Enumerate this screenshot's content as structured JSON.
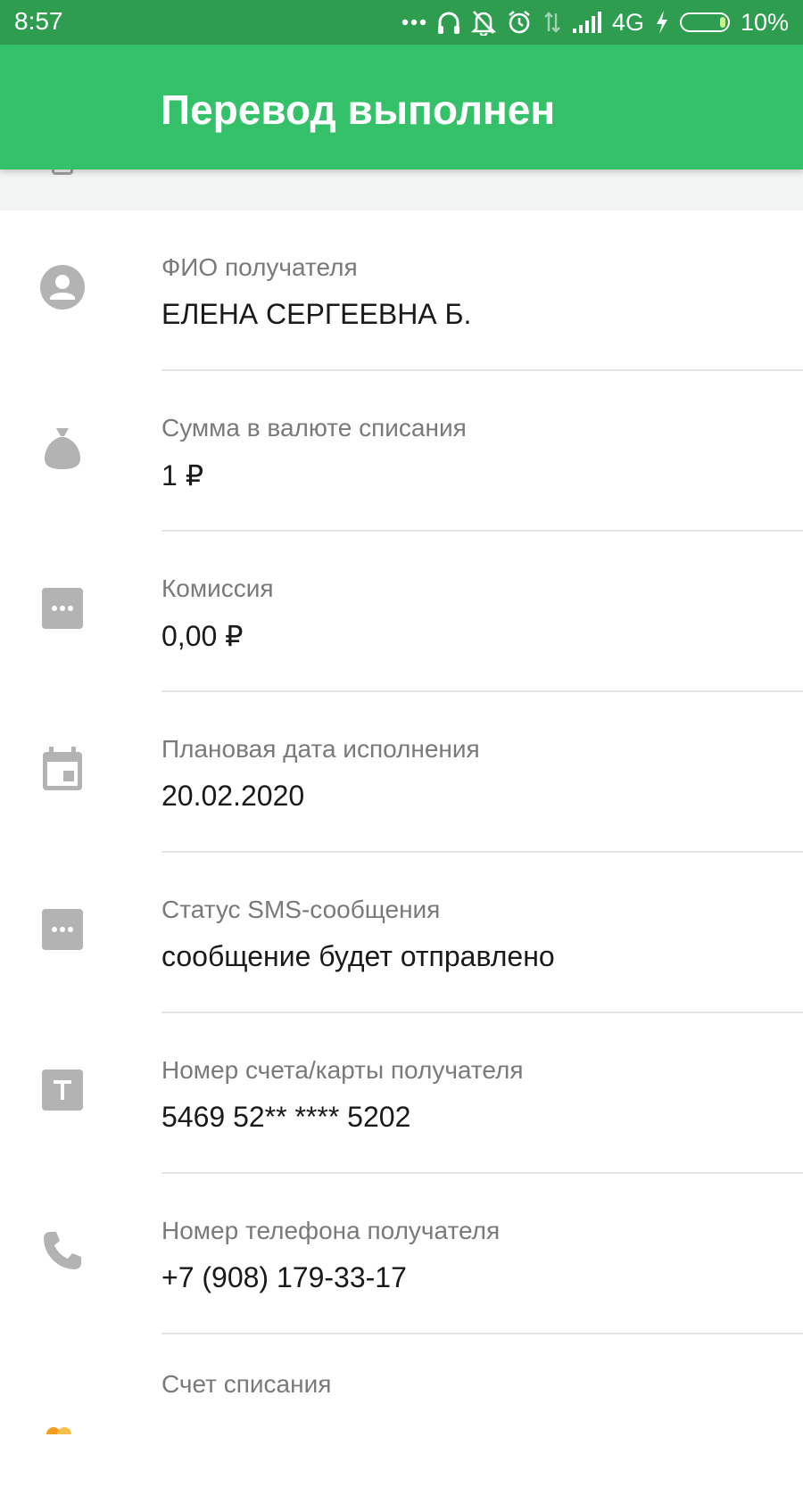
{
  "status_bar": {
    "time": "8:57",
    "network": "4G",
    "battery": "10%",
    "battery_level": 0.1,
    "icons": [
      "more-dots-icon",
      "headphones-icon",
      "bell-off-icon",
      "alarm-icon",
      "data-arrows-icon",
      "signal-icon",
      "charging-icon",
      "battery-icon"
    ]
  },
  "app_bar": {
    "title": "Перевод выполнен"
  },
  "colors": {
    "status_bar": "#2e9d4f",
    "app_bar": "#35c16a",
    "icon_gray": "#b3b3b3",
    "label_gray": "#7a7a7a"
  },
  "details": [
    {
      "icon": "person-icon",
      "label": "ФИО получателя",
      "value": "ЕЛЕНА СЕРГЕЕВНА Б."
    },
    {
      "icon": "money-bag-icon",
      "label": "Сумма в валюте списания",
      "value": "1 ₽"
    },
    {
      "icon": "dots-box-icon",
      "label": "Комиссия",
      "value": "0,00 ₽"
    },
    {
      "icon": "calendar-icon",
      "label": "Плановая дата исполнения",
      "value": "20.02.2020"
    },
    {
      "icon": "dots-box-icon",
      "label": "Статус SMS-сообщения",
      "value": "сообщение будет отправлено"
    },
    {
      "icon": "text-t-icon",
      "label": "Номер счета/карты получателя",
      "value": "5469 52** **** 5202"
    },
    {
      "icon": "phone-icon",
      "label": "Номер телефона получателя",
      "value": "+7 (908) 179-33-17"
    },
    {
      "icon": "card-icon",
      "label": "Счет списания"
    }
  ]
}
